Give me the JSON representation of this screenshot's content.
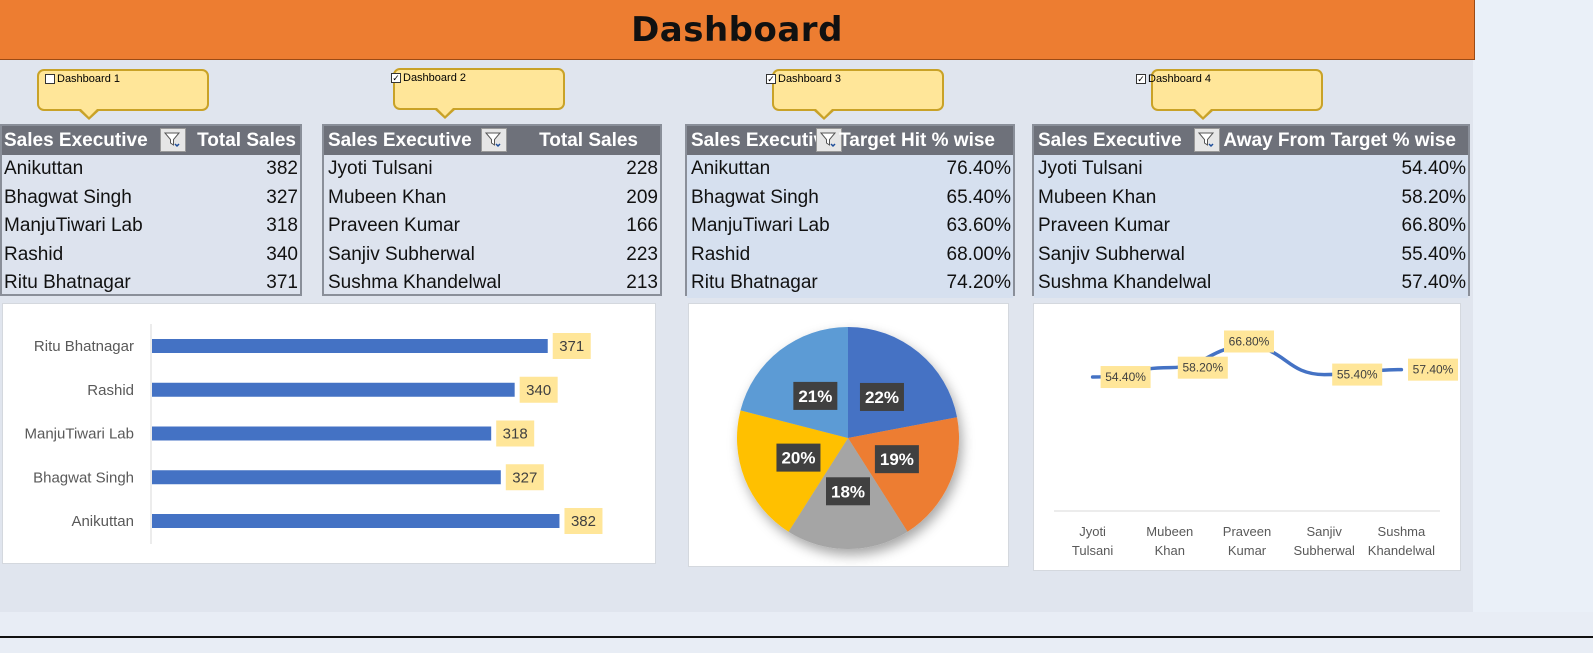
{
  "header": {
    "title": "Dashboard"
  },
  "checkboxes": [
    {
      "label": "Dashboard 1",
      "checked": false
    },
    {
      "label": "Dashboard 2",
      "checked": true
    },
    {
      "label": "Dashboard 3",
      "checked": true
    },
    {
      "label": "Dashboard 4",
      "checked": true
    }
  ],
  "pivots": [
    {
      "col1": "Sales Executive",
      "col2": "Total Sales",
      "rows": [
        {
          "name": "Anikuttan",
          "value": "382"
        },
        {
          "name": "Bhagwat Singh",
          "value": "327"
        },
        {
          "name": "ManjuTiwari Lab",
          "value": "318"
        },
        {
          "name": "Rashid",
          "value": "340"
        },
        {
          "name": "Ritu Bhatnagar",
          "value": "371"
        }
      ]
    },
    {
      "col1": "Sales Executive",
      "col2": "Total Sales",
      "rows": [
        {
          "name": "Jyoti Tulsani",
          "value": "228"
        },
        {
          "name": "Mubeen Khan",
          "value": "209"
        },
        {
          "name": "Praveen Kumar",
          "value": "166"
        },
        {
          "name": "Sanjiv Subherwal",
          "value": "223"
        },
        {
          "name": "Sushma Khandelwal",
          "value": "213"
        }
      ]
    },
    {
      "col1": "Sales Executiv",
      "col2": "Target Hit % wise",
      "rows": [
        {
          "name": "Anikuttan",
          "value": "76.40%"
        },
        {
          "name": "Bhagwat Singh",
          "value": "65.40%"
        },
        {
          "name": "ManjuTiwari Lab",
          "value": "63.60%"
        },
        {
          "name": "Rashid",
          "value": "68.00%"
        },
        {
          "name": "Ritu Bhatnagar",
          "value": "74.20%"
        }
      ]
    },
    {
      "col1": "Sales Executive",
      "col2": "Away From Target % wise",
      "rows": [
        {
          "name": "Jyoti Tulsani",
          "value": "54.40%"
        },
        {
          "name": "Mubeen Khan",
          "value": "58.20%"
        },
        {
          "name": "Praveen Kumar",
          "value": "66.80%"
        },
        {
          "name": "Sanjiv Subherwal",
          "value": "55.40%"
        },
        {
          "name": "Sushma Khandelwal",
          "value": "57.40%"
        }
      ]
    }
  ],
  "icons": {
    "filter": "filter-dropdown-icon",
    "checkbox": "checkbox-icon"
  },
  "chart_data": [
    {
      "type": "bar",
      "orientation": "horizontal",
      "categories": [
        "Anikuttan",
        "Bhagwat Singh",
        "ManjuTiwari Lab",
        "Rashid",
        "Ritu Bhatnagar"
      ],
      "values": [
        382,
        327,
        318,
        340,
        371
      ],
      "data_labels": [
        "382",
        "327",
        "318",
        "340",
        "371"
      ],
      "xlim": [
        0,
        450
      ],
      "grid": false,
      "color": "#4472c4",
      "label_bg": "#ffe699"
    },
    {
      "type": "pie",
      "slices": [
        {
          "value": 22,
          "label": "22%",
          "color": "#4472c4"
        },
        {
          "value": 19,
          "label": "19%",
          "color": "#ed7d31"
        },
        {
          "value": 18,
          "label": "18%",
          "color": "#a5a5a5"
        },
        {
          "value": 20,
          "label": "20%",
          "color": "#ffc000"
        },
        {
          "value": 21,
          "label": "21%",
          "color": "#5b9bd5"
        }
      ],
      "label_bg": "#404040"
    },
    {
      "type": "line",
      "categories": [
        "Jyoti Tulsani",
        "Mubeen Khan",
        "Praveen Kumar",
        "Sanjiv Subherwal",
        "Sushma Khandelwal"
      ],
      "category_lines": [
        [
          "Jyoti",
          "Tulsani"
        ],
        [
          "Mubeen",
          "Khan"
        ],
        [
          "Praveen",
          "Kumar"
        ],
        [
          "Sanjiv",
          "Subherwal"
        ],
        [
          "Sushma",
          "Khandelwal"
        ]
      ],
      "values": [
        54.4,
        58.2,
        66.8,
        55.4,
        57.4
      ],
      "data_labels": [
        "54.40%",
        "58.20%",
        "66.80%",
        "55.40%",
        "57.40%"
      ],
      "ylim": [
        0,
        80
      ],
      "grid": false,
      "color": "#4472c4",
      "label_bg": "#ffe699"
    }
  ]
}
